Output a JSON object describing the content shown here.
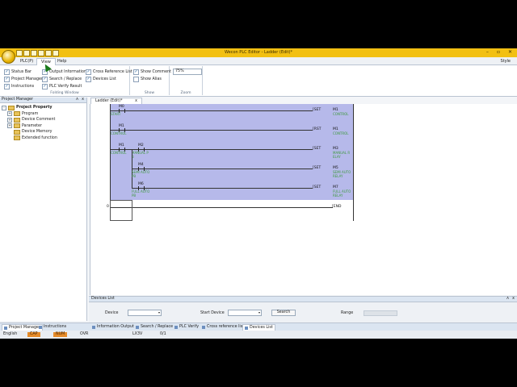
{
  "window": {
    "title": "Wecon PLC Editor - Ladder (Edit)*"
  },
  "window_controls": {
    "minimize": "–",
    "maximize": "▫",
    "close": "✕"
  },
  "ribbon_tabs": [
    {
      "label": "PLC(P)"
    },
    {
      "label": "View"
    },
    {
      "label": "Help"
    }
  ],
  "style_label": "Style",
  "folding_window": {
    "group_label": "Folding Window",
    "items": [
      {
        "label": "Status Bar",
        "checked": true
      },
      {
        "label": "Project Manager",
        "checked": true
      },
      {
        "label": "Instructions",
        "checked": true
      },
      {
        "label": "Output Information",
        "checked": true
      },
      {
        "label": "Search / Replace",
        "checked": true
      },
      {
        "label": "PLC Verify Result",
        "checked": true
      },
      {
        "label": "Cross Reference List",
        "checked": true
      },
      {
        "label": "Devices List",
        "checked": true
      }
    ]
  },
  "show_group": {
    "group_label": "Show",
    "items": [
      {
        "label": "Show Comment",
        "checked": true
      },
      {
        "label": "Show Alias",
        "checked": false
      }
    ]
  },
  "zoom_group": {
    "group_label": "Zoom",
    "value": "75%"
  },
  "project_manager": {
    "title": "Project Manager",
    "pin": "ᴧ",
    "close": "x",
    "nodes": [
      {
        "label": "Project Property",
        "expander": "-"
      },
      {
        "label": "Program",
        "expander": "+"
      },
      {
        "label": "Device Comment",
        "expander": "+"
      },
      {
        "label": "Parameter",
        "expander": "+"
      },
      {
        "label": "Device Memory",
        "expander": ""
      },
      {
        "label": "Extended function",
        "expander": ""
      }
    ]
  },
  "document_tab": {
    "label": "Ladder (Edit)*",
    "close": "x"
  },
  "ladder": {
    "rung0": {
      "contact": "M0",
      "contact_comment": "START",
      "instr": "SET",
      "coil": "M1",
      "coil_comment": "CONTROL"
    },
    "rung1": {
      "contact": "M1",
      "contact_comment": "CONTROL",
      "instr": "RST",
      "coil": "M1",
      "coil_comment": "CONTROL"
    },
    "rung2": {
      "contact1": "M1",
      "contact1_comment": "CONTROL",
      "contact2": "M2",
      "contact2_comment": [
        "MANUAL P",
        "B"
      ],
      "instr": "SET",
      "coil": "M3",
      "coil_comment": [
        "MANUAL R",
        "ELAY"
      ]
    },
    "rung3": {
      "contact": "M4",
      "contact_comment": [
        "SEMI AUTO",
        "PB"
      ],
      "instr": "SET",
      "coil": "M5",
      "coil_comment": [
        "SEMI AUTO",
        "RELAY"
      ]
    },
    "rung4": {
      "contact": "M6",
      "contact_comment": [
        "FULL AUTO",
        "PB"
      ],
      "instr": "SET",
      "coil": "M7",
      "coil_comment": [
        "FULL AUTO",
        "RELAY"
      ]
    },
    "end_step": "0",
    "end_instr": "END"
  },
  "devices_list": {
    "title": "Devices List",
    "pin": "ᴧ",
    "close": "x",
    "device_label": "Device",
    "start_device_label": "Start Device",
    "search_label": "Search",
    "range_label": "Range"
  },
  "bottom_tabs": [
    {
      "label": "Project Manager"
    },
    {
      "label": "Instructions"
    },
    {
      "label": "Information Output"
    },
    {
      "label": "Search / Replace"
    },
    {
      "label": "PLC Verify"
    },
    {
      "label": "Cross reference list"
    },
    {
      "label": "Devices List"
    }
  ],
  "status": {
    "language": "English",
    "caps": "CAP",
    "num": "NUM",
    "ovr": "OVR",
    "model": "LX3V",
    "position": "0/1"
  },
  "colors": {
    "title_bar": "#f2c012",
    "selection": "#b6b9ea",
    "comment_text": "#3f9a3f",
    "status_highlight": "#e58b2a"
  }
}
